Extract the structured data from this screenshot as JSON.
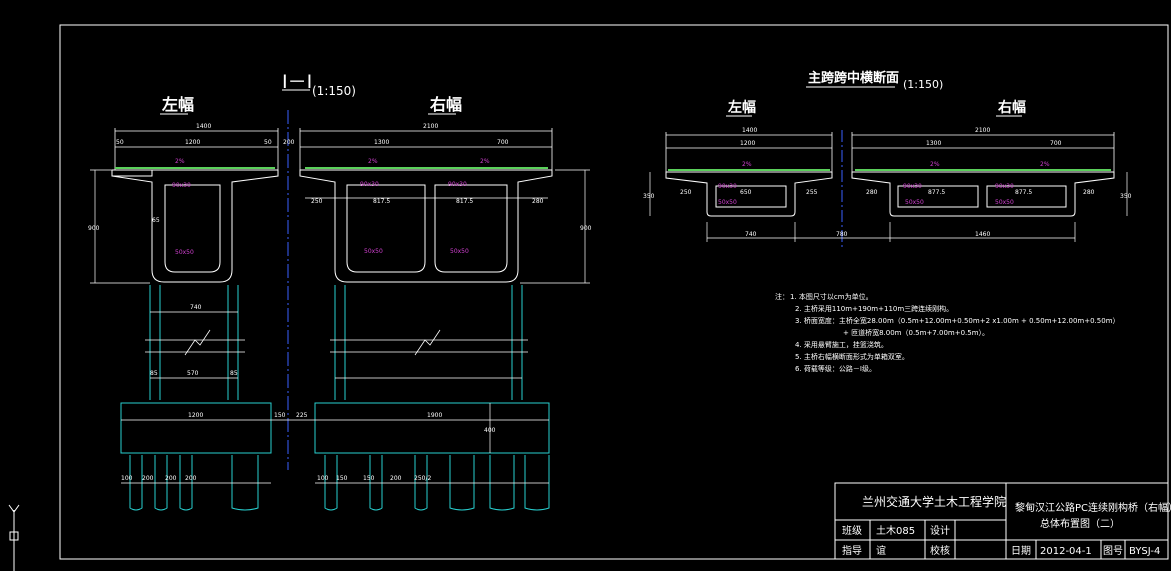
{
  "section_left": {
    "title": "I－I",
    "scale": "(1:150)",
    "left_label": "左幅",
    "right_label": "右幅",
    "dims": {
      "total_left": "1400",
      "total_right": "2100",
      "top_left": "1200",
      "top_right": "1300",
      "top_right2": "700",
      "web_a": "50",
      "web_b": "50",
      "median": "200",
      "slope_left": "2%",
      "slope_right": "2%",
      "slope_right2": "2%",
      "haunch_l": "90x30",
      "haunch_r1": "90x30",
      "haunch_r2": "90x30",
      "fillet_l": "50x50",
      "fillet_r1": "50x50",
      "fillet_r2": "50x50",
      "height": "900",
      "height_r": "900",
      "thick": "65",
      "cant_l": "250",
      "cant_r": "280",
      "box_a": "817.5",
      "box_b": "817.5",
      "web_c": "50",
      "web_d": "80",
      "cap_width": "740",
      "col_gap": "570",
      "col_a": "85",
      "col_b": "85",
      "footing_l": "1200",
      "footing_r": "1900",
      "footing_h": "400",
      "gap_mid": "150",
      "gap_mid2": "225",
      "pile_a": "100",
      "pile_b": "200",
      "pile_c": "200",
      "pile_d": "200",
      "pile_e": "250/2",
      "pile_f": "100",
      "pile_g": "150",
      "pile_h": "150",
      "pile_i": "200"
    }
  },
  "section_right": {
    "title": "主跨跨中横断面",
    "scale": "(1:150)",
    "left_label": "左幅",
    "right_label": "右幅",
    "dims": {
      "total_left": "1400",
      "total_right": "2100",
      "top_left": "1200",
      "top_right": "1300",
      "top_right2": "700",
      "inner_l": "650",
      "inner_r1": "877.5",
      "inner_r2": "877.5",
      "cant_l": "250",
      "cant_r1": "255",
      "cant_r2": "280",
      "cant_r3": "280",
      "height_l": "350",
      "height_r": "350",
      "haunch": "90x30",
      "haunch_r": "90x30",
      "haunch_r2": "90x30",
      "fillet_l": "50x50",
      "fillet_r": "50x50",
      "fillet_r2": "50x50",
      "bottom_l": "740",
      "bottom_mid": "780",
      "bottom_r": "1460",
      "slope": "2%",
      "slope_r": "2%",
      "slope_r2": "2%"
    }
  },
  "notes": {
    "prefix": "注：",
    "lines": [
      "1. 本图尺寸以cm为单位。",
      "2. 主桥采用110m+190m+110m三跨连续刚构。",
      "3. 桥面宽度：主桥全宽28.00m（0.5m+12.00m+0.50m+2 x1.00m + 0.50m+12.00m+0.50m）",
      "+ 匝道桥宽8.00m（0.5m+7.00m+0.5m）。",
      "4. 采用悬臂施工，挂篮浇筑。",
      "5. 主桥右幅横断面形式为单箱双室。",
      "6. 荷载等级：公路－I级。"
    ]
  },
  "title_block": {
    "school": "兰州交通大学土木工程学院",
    "project_line1": "黎甸汉江公路PC连续刚构桥（右幅）",
    "project_line2": "总体布置图（二）",
    "class_label": "班级",
    "class_value": "土木085",
    "design_label": "设计",
    "guide_label": "指导",
    "guide_value": "谊",
    "check_label": "校核",
    "date_label": "日期",
    "date_value": "2012-04-1",
    "drawing_no_label": "图号",
    "drawing_no_value": "BYSJ-4"
  }
}
